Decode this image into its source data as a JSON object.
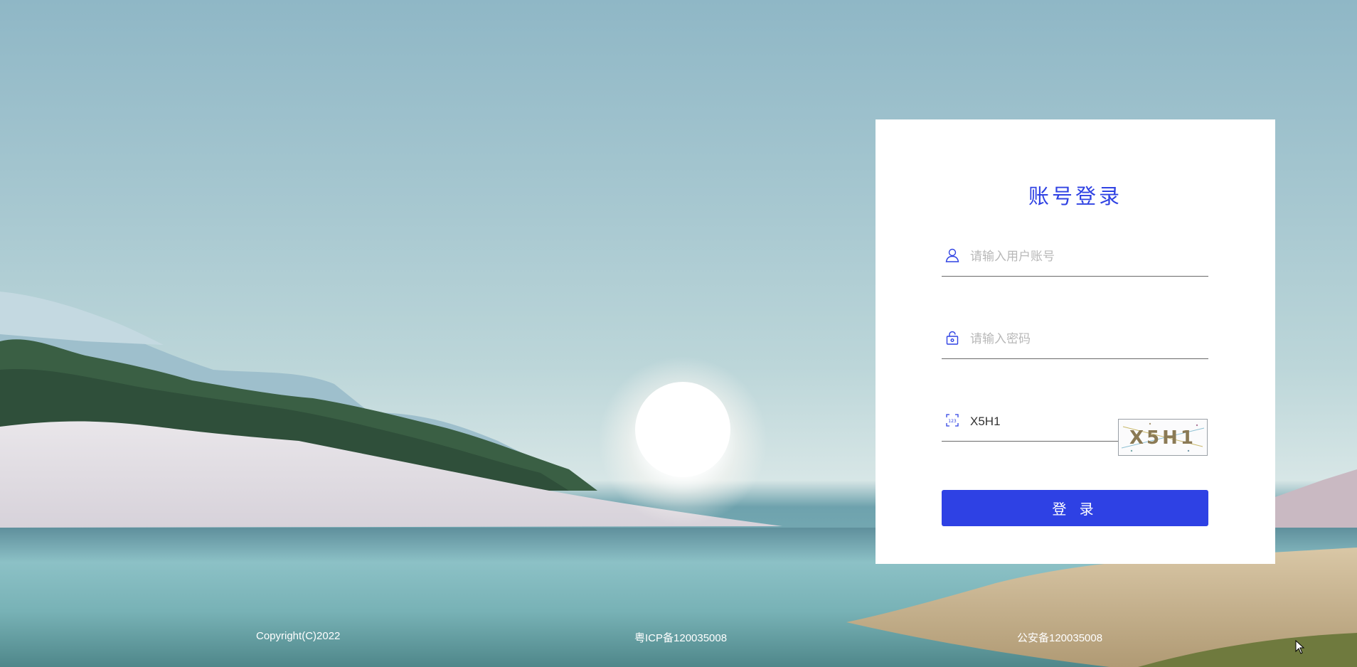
{
  "login": {
    "title": "账号登录",
    "username_placeholder": "请输入用户账号",
    "password_placeholder": "请输入密码",
    "captcha_value": "X5H1",
    "captcha_image_text": "X5H1",
    "submit_label": "登 录"
  },
  "icons": {
    "username": "user-icon",
    "password": "lock-icon",
    "captcha": "captcha-icon"
  },
  "footer": {
    "copyright": "Copyright(C)2022",
    "icp": "粤ICP备120035008",
    "police": "公安备120035008"
  },
  "colors": {
    "accent": "#2e41e4",
    "title": "#2f42e3",
    "card_background": "#ffffff"
  }
}
